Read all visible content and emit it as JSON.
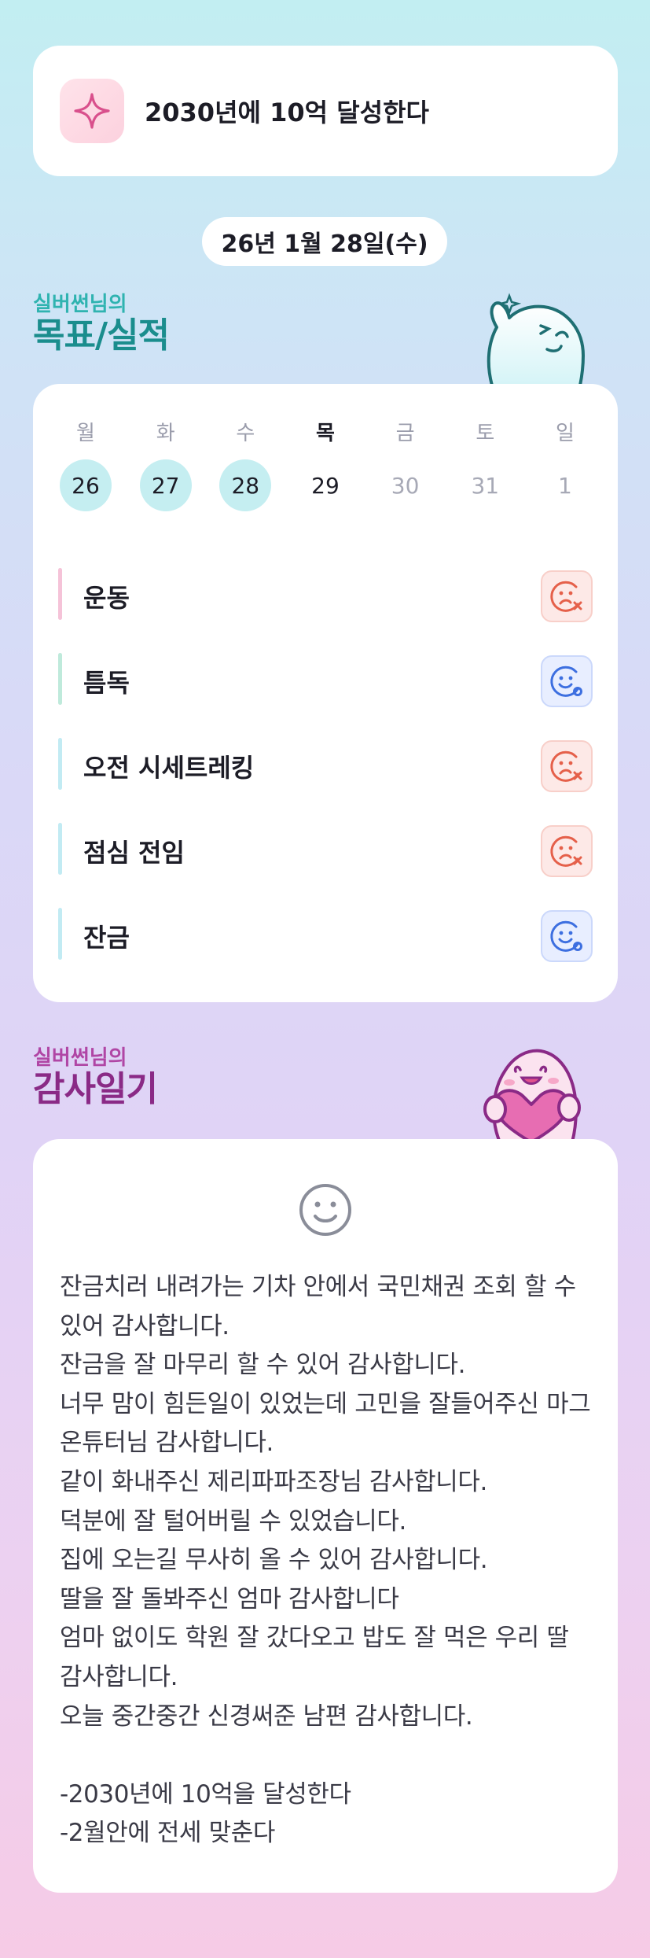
{
  "goal": {
    "text": "2030년에 10억 달성한다",
    "icon": "sparkle-icon"
  },
  "date": "26년 1월 28일(수)",
  "goals_section": {
    "subtitle": "실버썬님의",
    "title": "목표/실적"
  },
  "week": [
    {
      "name": "월",
      "num": "26",
      "done": true
    },
    {
      "name": "화",
      "num": "27",
      "done": true
    },
    {
      "name": "수",
      "num": "28",
      "done": true
    },
    {
      "name": "목",
      "num": "29",
      "today": true
    },
    {
      "name": "금",
      "num": "30"
    },
    {
      "name": "토",
      "num": "31"
    },
    {
      "name": "일",
      "num": "1"
    }
  ],
  "tasks": [
    {
      "label": "운동",
      "status": "fail",
      "bar_color": "#f5c3d8"
    },
    {
      "label": "틈독",
      "status": "ok",
      "bar_color": "#bfeadb"
    },
    {
      "label": "오전 시세트레킹",
      "status": "fail",
      "bar_color": "#c2ebf3"
    },
    {
      "label": "점심 전임",
      "status": "fail",
      "bar_color": "#c2ebf3"
    },
    {
      "label": "잔금",
      "status": "ok",
      "bar_color": "#c2ebf3"
    }
  ],
  "thanks_section": {
    "subtitle": "실버썬님의",
    "title": "감사일기"
  },
  "diary": {
    "icon": "smile-face-icon",
    "text": "잔금치러 내려가는 기차 안에서 국민채권 조회 할 수 있어 감사합니다.\n잔금을 잘 마무리 할 수 있어 감사합니다.\n너무 맘이 힘든일이 있었는데 고민을 잘들어주신 마그온튜터님 감사합니다.\n같이 화내주신 제리파파조장님 감사합니다.\n덕분에 잘 털어버릴 수 있었습니다.\n집에 오는길 무사히 올 수 있어 감사합니다.\n딸을 잘 돌봐주신 엄마 감사합니다\n엄마 없이도 학원 잘 갔다오고 밥도 잘 먹은 우리 딸 감사합니다.\n오늘 중간중간 신경써준 남편 감사합니다.\n\n-2030년에 10억을 달성한다\n-2월안에 전세 맞춘다"
  },
  "colors": {
    "accent_teal": "#1a8d8d",
    "accent_purple": "#8a2a86",
    "fail": "#e5604a",
    "ok": "#3d6fe0"
  }
}
